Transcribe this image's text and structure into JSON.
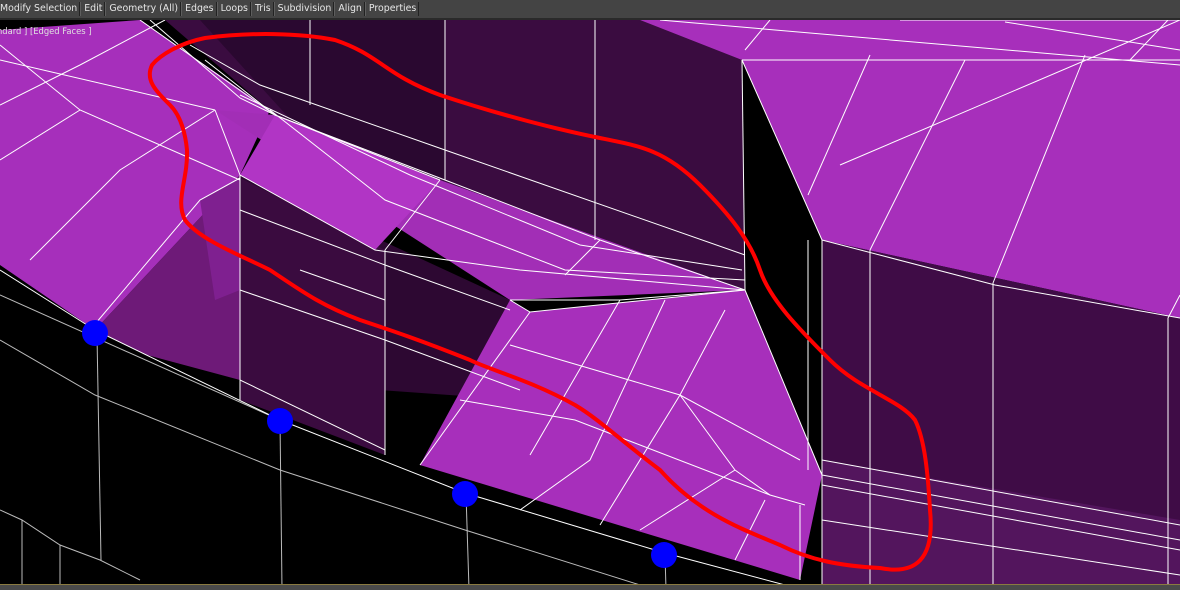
{
  "ribbon": {
    "items": [
      "Modify Selection",
      "Edit",
      "Geometry (All)",
      "Edges",
      "Loops",
      "Tris",
      "Subdivision",
      "Align",
      "Properties"
    ]
  },
  "viewport": {
    "label": "ndard ] [Edged Faces ]"
  },
  "colors": {
    "face_bright": "#a72fbb",
    "face_dark": "#3a0b3f",
    "wire": "#ffffff",
    "annotation": "#ff0000",
    "marker": "#0000ff"
  },
  "icons": [
    "selection-loop-annotation",
    "vertex-marker"
  ]
}
